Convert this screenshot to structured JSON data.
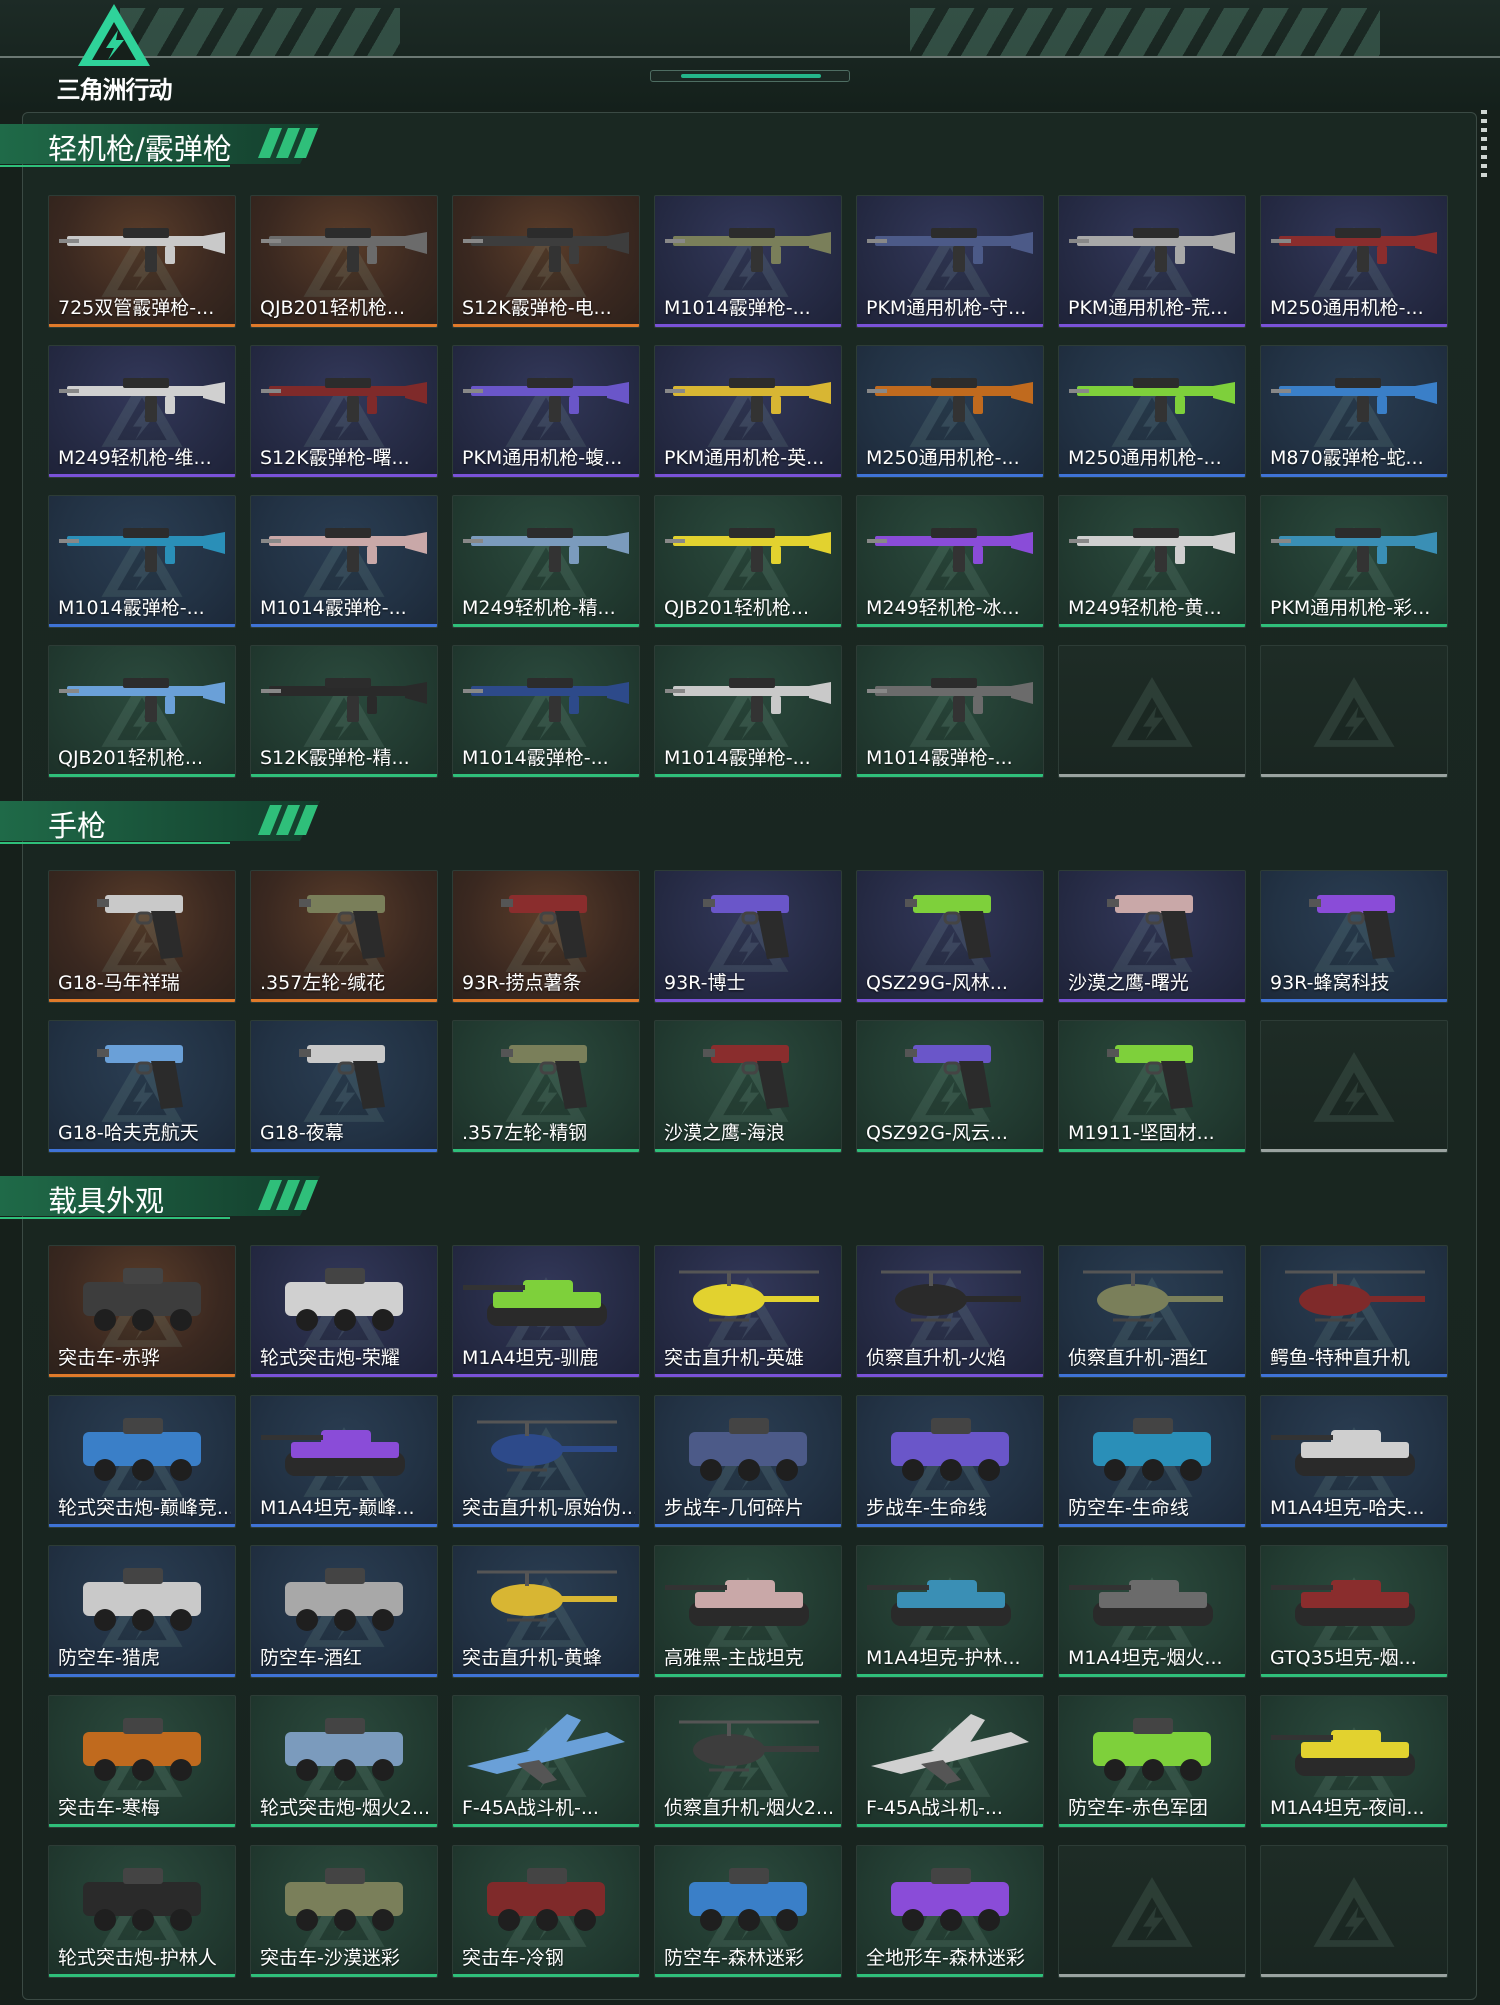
{
  "app": {
    "logo_text": "三角洲行动"
  },
  "colors": {
    "gold": "#e07a2a",
    "purple": "#7a52d8",
    "blue": "#3f73d6",
    "green": "#2fbf7a",
    "empty": "#9aa3a0",
    "accent": "#24b68a"
  },
  "sections": [
    {
      "title": "轻机枪/霰弹枪",
      "kind": "gun",
      "items": [
        {
          "name": "725双管霰弹枪-...",
          "rarity": "gold"
        },
        {
          "name": "QJB201轻机枪...",
          "rarity": "gold"
        },
        {
          "name": "S12K霰弹枪-电...",
          "rarity": "gold"
        },
        {
          "name": "M1014霰弹枪-...",
          "rarity": "purple"
        },
        {
          "name": "PKM通用机枪-守...",
          "rarity": "purple"
        },
        {
          "name": "PKM通用机枪-荒...",
          "rarity": "purple"
        },
        {
          "name": "M250通用机枪-...",
          "rarity": "purple"
        },
        {
          "name": "M249轻机枪-维...",
          "rarity": "purple"
        },
        {
          "name": "S12K霰弹枪-曙...",
          "rarity": "purple"
        },
        {
          "name": "PKM通用机枪-蝮...",
          "rarity": "purple"
        },
        {
          "name": "PKM通用机枪-英...",
          "rarity": "purple"
        },
        {
          "name": "M250通用机枪-...",
          "rarity": "blue"
        },
        {
          "name": "M250通用机枪-...",
          "rarity": "blue"
        },
        {
          "name": "M870霰弹枪-蛇...",
          "rarity": "blue"
        },
        {
          "name": "M1014霰弹枪-...",
          "rarity": "blue"
        },
        {
          "name": "M1014霰弹枪-...",
          "rarity": "blue"
        },
        {
          "name": "M249轻机枪-精...",
          "rarity": "green"
        },
        {
          "name": "QJB201轻机枪...",
          "rarity": "green"
        },
        {
          "name": "M249轻机枪-冰...",
          "rarity": "green"
        },
        {
          "name": "M249轻机枪-黄...",
          "rarity": "green"
        },
        {
          "name": "PKM通用机枪-彩...",
          "rarity": "green"
        },
        {
          "name": "QJB201轻机枪...",
          "rarity": "green"
        },
        {
          "name": "S12K霰弹枪-精...",
          "rarity": "green"
        },
        {
          "name": "M1014霰弹枪-...",
          "rarity": "green"
        },
        {
          "name": "M1014霰弹枪-...",
          "rarity": "green"
        },
        {
          "name": "M1014霰弹枪-...",
          "rarity": "green"
        },
        {
          "name": "",
          "rarity": "empty"
        },
        {
          "name": "",
          "rarity": "empty"
        }
      ]
    },
    {
      "title": "手枪",
      "kind": "pistol",
      "items": [
        {
          "name": "G18-马年祥瑞",
          "rarity": "gold"
        },
        {
          "name": ".357左轮-缄花",
          "rarity": "gold"
        },
        {
          "name": "93R-捞点薯条",
          "rarity": "gold"
        },
        {
          "name": "93R-博士",
          "rarity": "purple"
        },
        {
          "name": "QSZ29G-风林...",
          "rarity": "purple"
        },
        {
          "name": "沙漠之鹰-曙光",
          "rarity": "purple"
        },
        {
          "name": "93R-蜂窝科技",
          "rarity": "blue"
        },
        {
          "name": "G18-哈夫克航天",
          "rarity": "blue"
        },
        {
          "name": "G18-夜幕",
          "rarity": "blue"
        },
        {
          "name": ".357左轮-精钢",
          "rarity": "green"
        },
        {
          "name": "沙漠之鹰-海浪",
          "rarity": "green"
        },
        {
          "name": "QSZ92G-风云...",
          "rarity": "green"
        },
        {
          "name": "M1911-坚固材...",
          "rarity": "green"
        },
        {
          "name": "",
          "rarity": "empty"
        }
      ]
    },
    {
      "title": "载具外观",
      "kind": "vehicle",
      "items": [
        {
          "name": "突击车-赤骅",
          "rarity": "gold"
        },
        {
          "name": "轮式突击炮-荣耀",
          "rarity": "purple"
        },
        {
          "name": "M1A4坦克-驯鹿",
          "rarity": "purple"
        },
        {
          "name": "突击直升机-英雄",
          "rarity": "purple"
        },
        {
          "name": "侦察直升机-火焰",
          "rarity": "purple"
        },
        {
          "name": "侦察直升机-酒红",
          "rarity": "blue"
        },
        {
          "name": "鳄鱼-特种直升机",
          "rarity": "blue"
        },
        {
          "name": "轮式突击炮-巅峰竞...",
          "rarity": "blue"
        },
        {
          "name": "M1A4坦克-巅峰...",
          "rarity": "blue"
        },
        {
          "name": "突击直升机-原始伪...",
          "rarity": "blue"
        },
        {
          "name": "步战车-几何碎片",
          "rarity": "blue"
        },
        {
          "name": "步战车-生命线",
          "rarity": "blue"
        },
        {
          "name": "防空车-生命线",
          "rarity": "blue"
        },
        {
          "name": "M1A4坦克-哈夫...",
          "rarity": "blue"
        },
        {
          "name": "防空车-猎虎",
          "rarity": "blue"
        },
        {
          "name": "防空车-酒红",
          "rarity": "blue"
        },
        {
          "name": "突击直升机-黄蜂",
          "rarity": "blue"
        },
        {
          "name": "高雅黑-主战坦克",
          "rarity": "green"
        },
        {
          "name": "M1A4坦克-护林...",
          "rarity": "green"
        },
        {
          "name": "M1A4坦克-烟火...",
          "rarity": "green"
        },
        {
          "name": "GTQ35坦克-烟...",
          "rarity": "green"
        },
        {
          "name": "突击车-寒梅",
          "rarity": "green"
        },
        {
          "name": "轮式突击炮-烟火2...",
          "rarity": "green"
        },
        {
          "name": "F-45A战斗机-...",
          "rarity": "green"
        },
        {
          "name": "侦察直升机-烟火2...",
          "rarity": "green"
        },
        {
          "name": "F-45A战斗机-...",
          "rarity": "green"
        },
        {
          "name": "防空车-赤色军团",
          "rarity": "green"
        },
        {
          "name": "M1A4坦克-夜间...",
          "rarity": "green"
        },
        {
          "name": "轮式突击炮-护林人",
          "rarity": "green"
        },
        {
          "name": "突击车-沙漠迷彩",
          "rarity": "green"
        },
        {
          "name": "突击车-冷钢",
          "rarity": "green"
        },
        {
          "name": "防空车-森林迷彩",
          "rarity": "green"
        },
        {
          "name": "全地形车-森林迷彩",
          "rarity": "green"
        },
        {
          "name": "",
          "rarity": "empty"
        },
        {
          "name": "",
          "rarity": "empty"
        }
      ]
    }
  ]
}
